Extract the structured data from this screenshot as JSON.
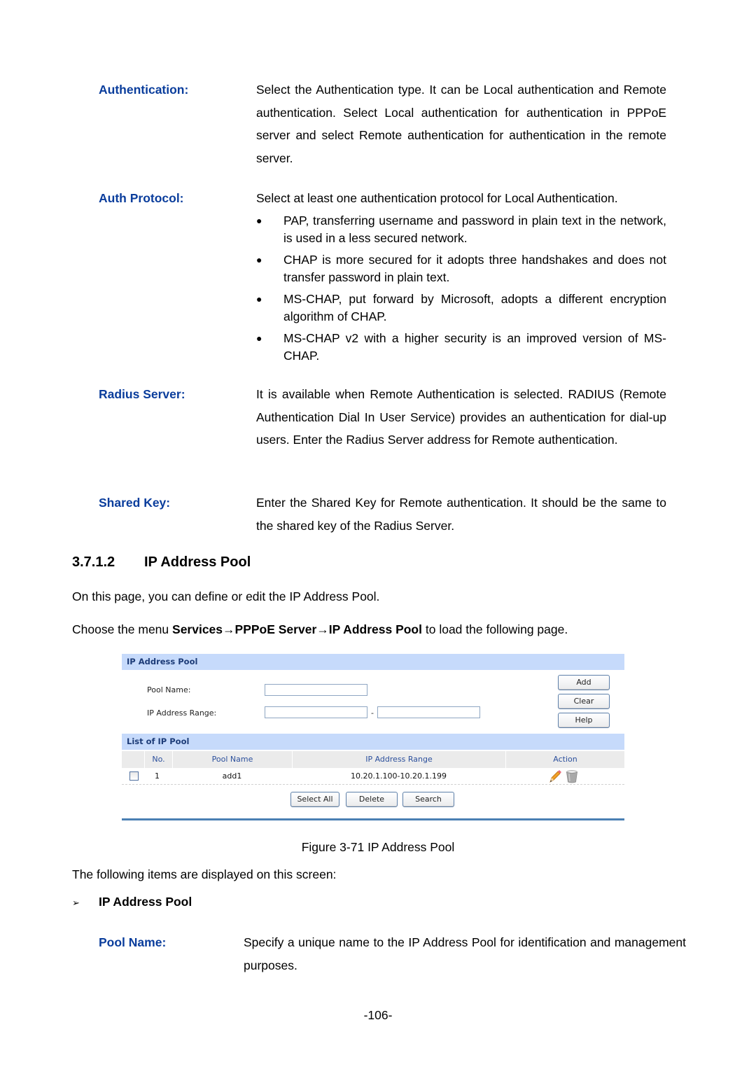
{
  "definitions_top": [
    {
      "term": "Authentication:",
      "description": "Select the Authentication type. It can be Local authentication and Remote authentication. Select Local authentication for authentication in PPPoE server and select Remote authentication for authentication in the remote server."
    },
    {
      "term": "Auth Protocol:",
      "description": "Select at least one authentication protocol for Local Authentication.",
      "bullets": [
        "PAP, transferring username and password in plain text in the network, is used in a less secured network.",
        "CHAP is more secured for it adopts three handshakes and does not transfer password in plain text.",
        "MS-CHAP, put forward by Microsoft, adopts a different encryption algorithm of CHAP.",
        "MS-CHAP v2 with a higher security is an improved version of MS-CHAP."
      ]
    },
    {
      "term": "Radius Server:",
      "description": "It is available when Remote Authentication is selected. RADIUS (Remote Authentication Dial In User Service) provides an authentication for dial-up users. Enter the Radius Server address for Remote authentication."
    },
    {
      "term": "Shared Key:",
      "description": "Enter the Shared Key for Remote authentication. It should be the same to the shared key of the Radius Server."
    }
  ],
  "section": {
    "number": "3.7.1.2",
    "title": "IP Address Pool",
    "intro": "On this page, you can define or edit the IP Address Pool.",
    "menu_prefix": "Choose the menu ",
    "menu_path": "Services→PPPoE Server→IP Address Pool",
    "menu_suffix": " to load the following page."
  },
  "panel": {
    "config_header": "IP Address Pool",
    "pool_name_label": "Pool Name:",
    "pool_name_value": "",
    "ip_range_label": "IP Address Range:",
    "ip_range_start_value": "",
    "ip_range_separator": "-",
    "ip_range_end_value": "",
    "buttons": {
      "add": "Add",
      "clear": "Clear",
      "help": "Help"
    },
    "list_header": "List of IP Pool",
    "columns": [
      "",
      "No.",
      "Pool Name",
      "IP Address Range",
      "Action"
    ],
    "rows": [
      {
        "checked": false,
        "no": "1",
        "pool_name": "add1",
        "ip_range": "10.20.1.100-10.20.1.199",
        "actions": [
          "edit-icon",
          "delete-icon"
        ]
      }
    ],
    "list_buttons": {
      "select_all": "Select All",
      "delete": "Delete",
      "search": "Search"
    },
    "colors": {
      "header_bg": "#c6dafb",
      "header_text": "#1d3c78",
      "bottom_line": "#4b7fb3"
    }
  },
  "figure_caption": "Figure 3-71 IP Address Pool",
  "items_intro": "The following items are displayed on this screen:",
  "subsection": {
    "marker": "➢",
    "title": "IP Address Pool"
  },
  "definitions_bottom": [
    {
      "term": "Pool Name:",
      "description": "Specify a unique name to the IP Address Pool for identification and management purposes."
    }
  ],
  "page_number": "-106-",
  "colors": {
    "term": "#0a3d9c",
    "text": "#000000"
  }
}
